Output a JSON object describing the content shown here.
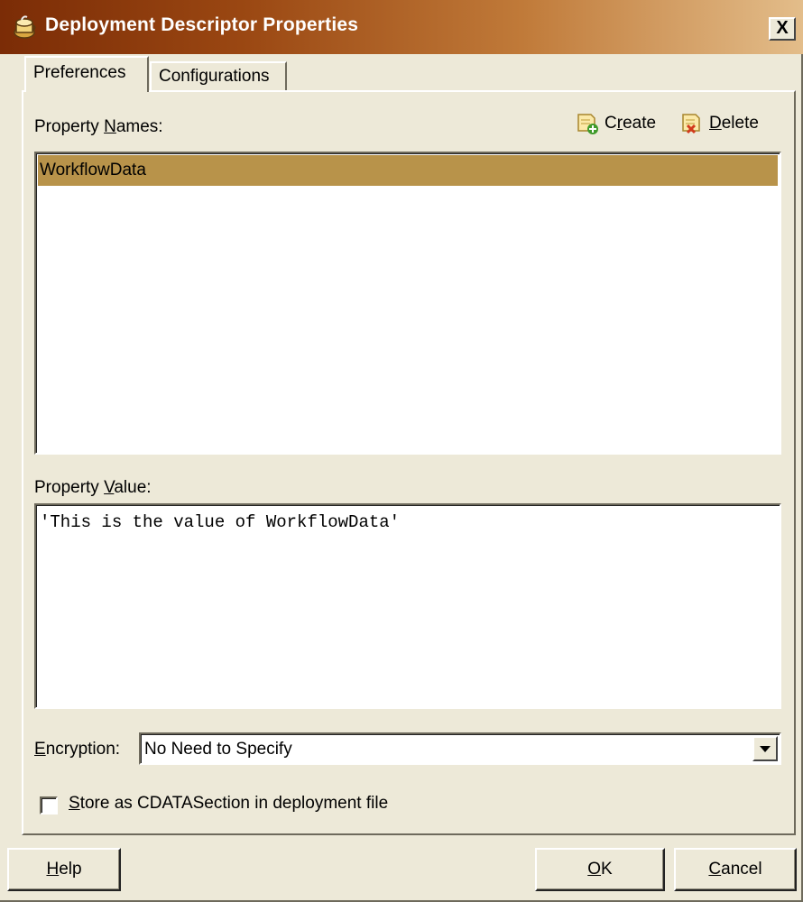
{
  "window": {
    "title": "Deployment Descriptor Properties",
    "close_label": "X"
  },
  "tabs": [
    {
      "label": "Preferences",
      "selected": true
    },
    {
      "label": "Configurations",
      "selected": false
    }
  ],
  "property_names": {
    "label_pre": "Property ",
    "label_mnemonic": "N",
    "label_post": "ames:",
    "items": [
      "WorkflowData"
    ],
    "selected_index": 0
  },
  "toolbar": {
    "create_pre": "C",
    "create_mnemonic": "r",
    "create_post": "eate",
    "delete_mnemonic": "D",
    "delete_post": "elete",
    "create_icon": "note-add-icon",
    "delete_icon": "note-delete-icon"
  },
  "property_value": {
    "label_pre": "Property ",
    "label_mnemonic": "V",
    "label_post": "alue:",
    "text": "'This is the value of WorkflowData'"
  },
  "encryption": {
    "label_mnemonic": "E",
    "label_post": "ncryption:",
    "selected": "No Need to Specify"
  },
  "cdata": {
    "checked": false,
    "label_mnemonic": "S",
    "label_post": "tore as CDATASection in deployment file"
  },
  "buttons": {
    "help_mnemonic": "H",
    "help_post": "elp",
    "ok_mnemonic": "O",
    "ok_post": "K",
    "cancel_mnemonic": "C",
    "cancel_post": "ancel"
  },
  "colors": {
    "title_start": "#7b2c06",
    "title_end": "#e3bd8a",
    "selection": "#b8934a",
    "face": "#ede9d8"
  }
}
